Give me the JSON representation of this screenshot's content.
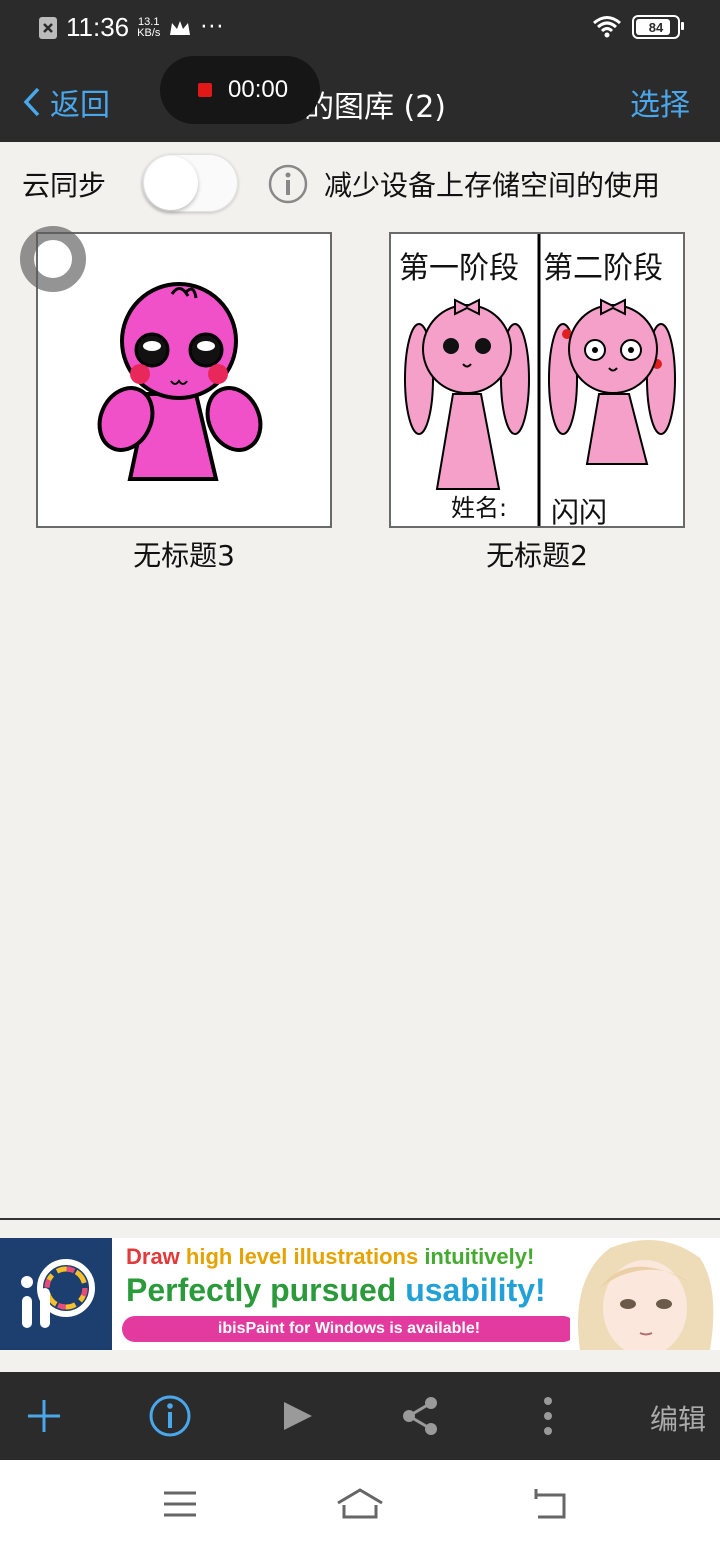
{
  "status_bar": {
    "time": "11:36",
    "net_speed_value": "13.1",
    "net_speed_unit": "KB/s",
    "more": "···",
    "battery": "84",
    "icons": [
      "notification-x-icon",
      "crown-icon",
      "wifi-icon",
      "battery-icon"
    ]
  },
  "recording": {
    "time": "00:00"
  },
  "nav": {
    "back_label": "返回",
    "title": "我的图库 (2)",
    "select_label": "选择"
  },
  "sync": {
    "label": "云同步",
    "toggle_on": false,
    "description": "减少设备上存储空间的使用"
  },
  "gallery": {
    "items": [
      {
        "title": "无标题3"
      },
      {
        "title": "无标题2",
        "art_text": [
          "第一阶段",
          "第二阶段",
          "姓名:",
          "闪闪"
        ]
      }
    ]
  },
  "ad": {
    "line1": [
      "Draw ",
      "high level illustrations ",
      "intuitively!"
    ],
    "line2": [
      "Perfectly pursued ",
      "usability!"
    ],
    "cta": "ibisPaint for Windows is available!"
  },
  "toolbar": {
    "edit_label": "编辑",
    "icons": [
      "add-icon",
      "info-icon",
      "play-icon",
      "share-icon",
      "more-vertical-icon"
    ]
  },
  "colors": {
    "accent": "#4aa7ec",
    "bar": "#2b2b2b",
    "background": "#f2f1ed",
    "pink": "#f050c8"
  }
}
